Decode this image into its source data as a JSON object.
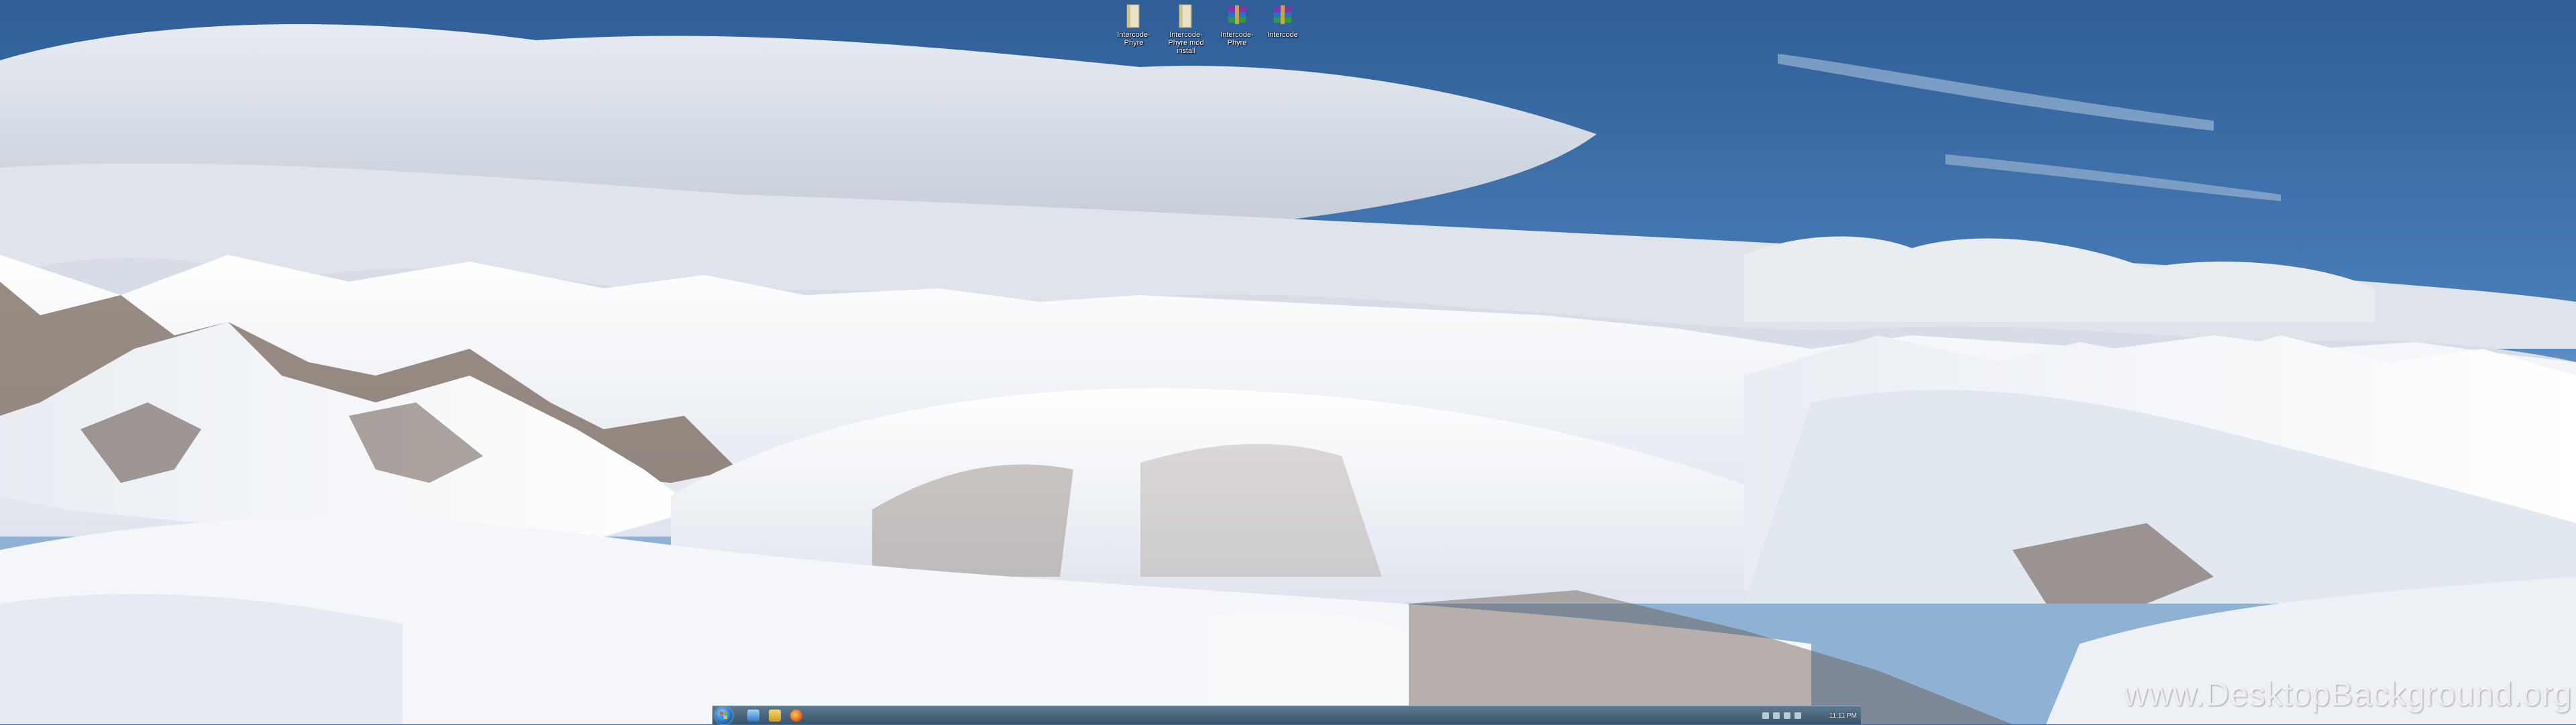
{
  "desktop": {
    "icons": [
      {
        "name": "folder-icon",
        "label": "Intercode-Phyre"
      },
      {
        "name": "folder-icon",
        "label": "Intercode-Phyre mod install"
      },
      {
        "name": "winrar-icon",
        "label": "Intercode-Phyre"
      },
      {
        "name": "winrar-icon",
        "label": "Intercode"
      }
    ],
    "wallpaper": "snow-mountain-range-panorama"
  },
  "taskbar": {
    "pinned": [
      "internet-explorer-icon",
      "windows-explorer-icon",
      "firefox-icon"
    ],
    "clock": "11:11 PM"
  },
  "watermark": "www.DesktopBackground.org",
  "colors": {
    "sky": "#3e6ea8",
    "snow": "#f2f4f8",
    "rock": "#5a4a40",
    "taskbar": "#4a6478"
  }
}
